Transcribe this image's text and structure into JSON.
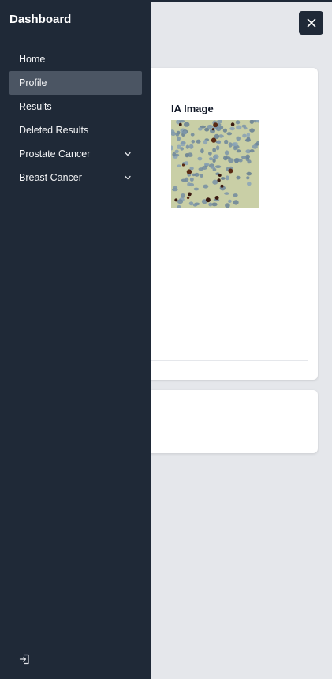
{
  "sidebar": {
    "title": "Dashboard",
    "items": [
      {
        "label": "Home",
        "active": false,
        "has_chevron": false
      },
      {
        "label": "Profile",
        "active": true,
        "has_chevron": false
      },
      {
        "label": "Results",
        "active": false,
        "has_chevron": false
      },
      {
        "label": "Deleted Results",
        "active": false,
        "has_chevron": false
      },
      {
        "label": "Prostate Cancer",
        "active": false,
        "has_chevron": true,
        "icon": "chevron-down-icon"
      },
      {
        "label": "Breast Cancer",
        "active": false,
        "has_chevron": true,
        "icon": "chevron-down-icon"
      }
    ],
    "logout_icon": "logout-icon"
  },
  "main": {
    "image_label": "IA Image",
    "image_icon": "histology-image"
  },
  "close_button": {
    "icon": "close-icon"
  },
  "colors": {
    "sidebar_bg": "#1f2937",
    "active_item_bg": "#4b5563",
    "page_bg": "#e5e7eb",
    "card_bg": "#ffffff"
  }
}
